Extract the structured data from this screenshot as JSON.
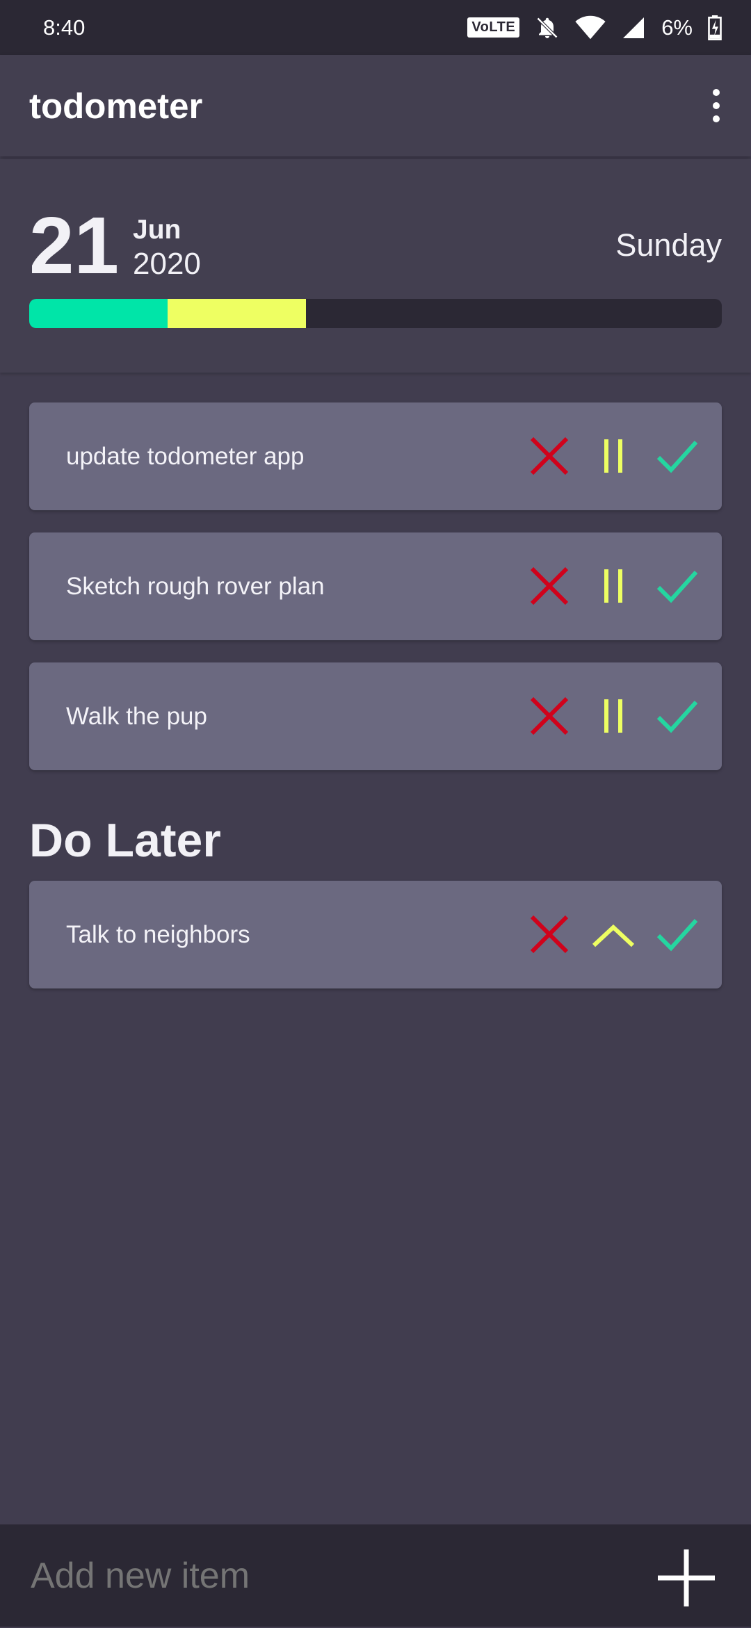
{
  "status": {
    "time": "8:40",
    "volte": "VoLTE",
    "battery": "6%"
  },
  "app": {
    "title": "todometer"
  },
  "date": {
    "day": "21",
    "month": "Jun",
    "year": "2020",
    "weekday": "Sunday"
  },
  "progress": {
    "done_fraction": 0.2,
    "paused_fraction": 0.2,
    "colors": {
      "done": "#00e5a8",
      "paused": "#eeff62",
      "track": "#2b2834"
    }
  },
  "tasks": [
    {
      "text": "update todometer app"
    },
    {
      "text": "Sketch rough rover plan"
    },
    {
      "text": "Walk the pup"
    }
  ],
  "do_later": {
    "title": "Do Later",
    "tasks": [
      {
        "text": "Talk to neighbors"
      }
    ]
  },
  "add": {
    "placeholder": "Add new item"
  },
  "icons": {
    "delete": "x-icon",
    "pause": "pause-icon",
    "resume": "chevron-up-icon",
    "complete": "check-icon",
    "add": "plus-icon",
    "menu": "more-vert-icon"
  },
  "colors": {
    "delete": "#d0021b",
    "pause": "#eeff62",
    "complete": "#25d6a0"
  }
}
